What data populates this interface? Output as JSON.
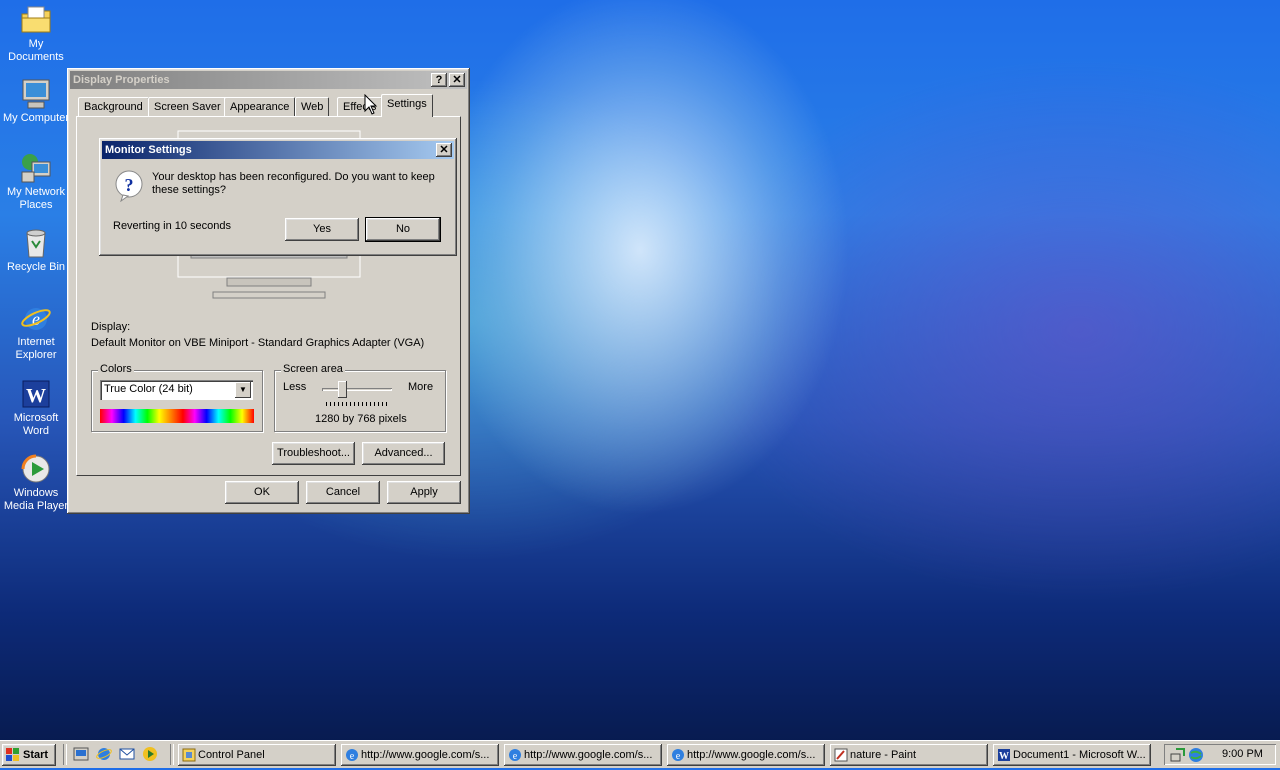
{
  "desktop": {
    "icons": [
      {
        "label": "My Documents",
        "icon": "folder-documents-icon"
      },
      {
        "label": "My Computer",
        "icon": "computer-icon"
      },
      {
        "label": "My Network Places",
        "icon": "network-icon"
      },
      {
        "label": "Recycle Bin",
        "icon": "recycle-bin-icon"
      },
      {
        "label": "Internet Explorer",
        "icon": "internet-explorer-icon"
      },
      {
        "label": "Microsoft Word",
        "icon": "word-icon"
      },
      {
        "label": "Windows Media Player",
        "icon": "media-player-icon"
      }
    ]
  },
  "display_properties": {
    "title": "Display Properties",
    "help": "?",
    "close": "✕",
    "tabs": [
      "Background",
      "Screen Saver",
      "Appearance",
      "Web",
      "Effects",
      "Settings"
    ],
    "selected_tab": "Settings",
    "display_label": "Display:",
    "display_value": "Default Monitor on VBE Miniport - Standard Graphics Adapter (VGA)",
    "colors_label": "Colors",
    "colors_value": "True Color (24 bit)",
    "screen_area_label": "Screen area",
    "less": "Less",
    "more": "More",
    "resolution": "1280 by 768 pixels",
    "troubleshoot": "Troubleshoot...",
    "advanced": "Advanced...",
    "ok": "OK",
    "cancel": "Cancel",
    "apply": "Apply"
  },
  "monitor_settings": {
    "title": "Monitor Settings",
    "close": "✕",
    "message": "Your desktop has been reconfigured.  Do you want to keep these settings?",
    "countdown": "Reverting in 10 seconds",
    "yes": "Yes",
    "no": "No"
  },
  "taskbar": {
    "start": "Start",
    "tasks": [
      {
        "label": "Control Panel",
        "icon": "control-panel-icon"
      },
      {
        "label": "http://www.google.com/s...",
        "icon": "internet-explorer-icon"
      },
      {
        "label": "http://www.google.com/s...",
        "icon": "internet-explorer-icon"
      },
      {
        "label": "http://www.google.com/s...",
        "icon": "internet-explorer-icon"
      },
      {
        "label": "nature - Paint",
        "icon": "paint-icon"
      },
      {
        "label": "Document1 - Microsoft W...",
        "icon": "word-icon"
      }
    ],
    "clock": "9:00 PM"
  }
}
